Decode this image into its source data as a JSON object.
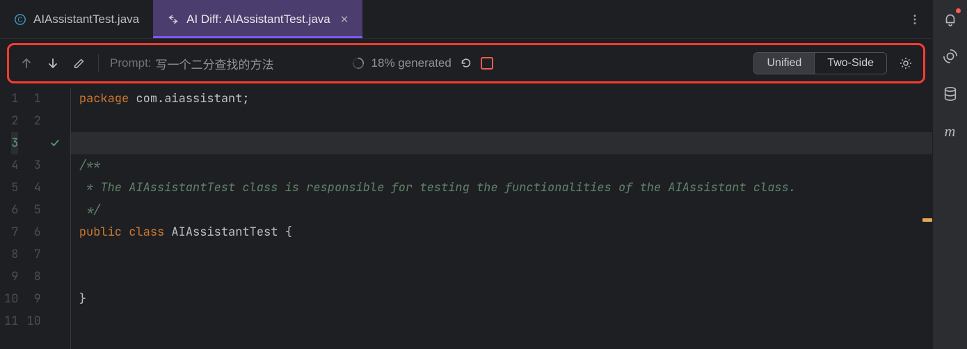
{
  "tabs": [
    {
      "label": "AIAssistantTest.java",
      "icon": "class-icon",
      "active": false
    },
    {
      "label": "AI Diff: AIAssistantTest.java",
      "icon": "diff-icon",
      "active": true
    }
  ],
  "toolbar": {
    "prompt_label": "Prompt:",
    "prompt_value": "写一个二分查找的方法",
    "progress_text": "18% generated",
    "view_modes": {
      "unified": "Unified",
      "two_side": "Two-Side"
    }
  },
  "editor": {
    "gutter": [
      {
        "left": "1",
        "right": "1",
        "caret": ""
      },
      {
        "left": "2",
        "right": "2",
        "caret": ""
      },
      {
        "left": "3",
        "right": "",
        "caret": "check",
        "current": true
      },
      {
        "left": "4",
        "right": "3",
        "caret": ""
      },
      {
        "left": "5",
        "right": "4",
        "caret": ""
      },
      {
        "left": "6",
        "right": "5",
        "caret": ""
      },
      {
        "left": "7",
        "right": "6",
        "caret": ""
      },
      {
        "left": "8",
        "right": "7",
        "caret": ""
      },
      {
        "left": "9",
        "right": "8",
        "caret": ""
      },
      {
        "left": "10",
        "right": "9",
        "caret": ""
      },
      {
        "left": "11",
        "right": "10",
        "caret": ""
      }
    ],
    "lines": {
      "l1_kw1": "package",
      "l1_rest": " com.aiassistant;",
      "l4": "/**",
      "l5": " * The AIAssistantTest class is responsible for testing the functionalities of the AIAssistant class.",
      "l6": " */",
      "l7_kw1": "public",
      "l7_kw2": "class",
      "l7_name": "AIAssistantTest",
      "l7_brace": " {",
      "l10": "}"
    }
  },
  "rail": {
    "m_label": "m"
  }
}
